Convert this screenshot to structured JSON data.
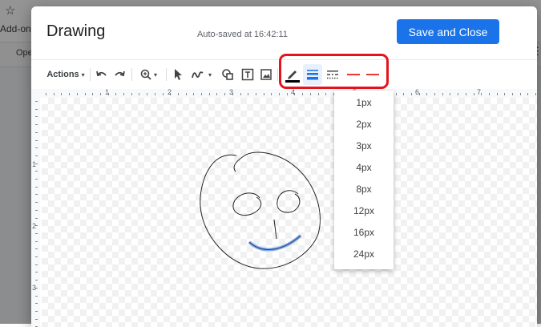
{
  "background": {
    "addons_text": "Add-on",
    "open_text": "Oper"
  },
  "dialog": {
    "title": "Drawing",
    "autosave": "Auto-saved at 16:42:11",
    "save_label": "Save and Close"
  },
  "toolbar": {
    "actions_label": "Actions",
    "icons": [
      "undo-icon",
      "redo-icon",
      "zoom-icon",
      "select-icon",
      "line-tool-icon",
      "shape-icon",
      "textbox-icon",
      "image-icon",
      "line-color-icon",
      "line-weight-icon",
      "line-dash-icon",
      "line-start-icon",
      "line-end-icon"
    ],
    "colors": {
      "highlight": "#e8121b",
      "line_color_swatch": "#000000",
      "accent": "#1a73e8",
      "active_weight_bg": "#e8f0fe"
    }
  },
  "ruler": {
    "horizontal": [
      "1",
      "2",
      "3",
      "4",
      "5",
      "6",
      "7"
    ],
    "vertical": [
      "1",
      "2",
      "3"
    ]
  },
  "line_weight_menu": {
    "options": [
      "1px",
      "2px",
      "3px",
      "4px",
      "8px",
      "12px",
      "16px",
      "24px"
    ]
  }
}
